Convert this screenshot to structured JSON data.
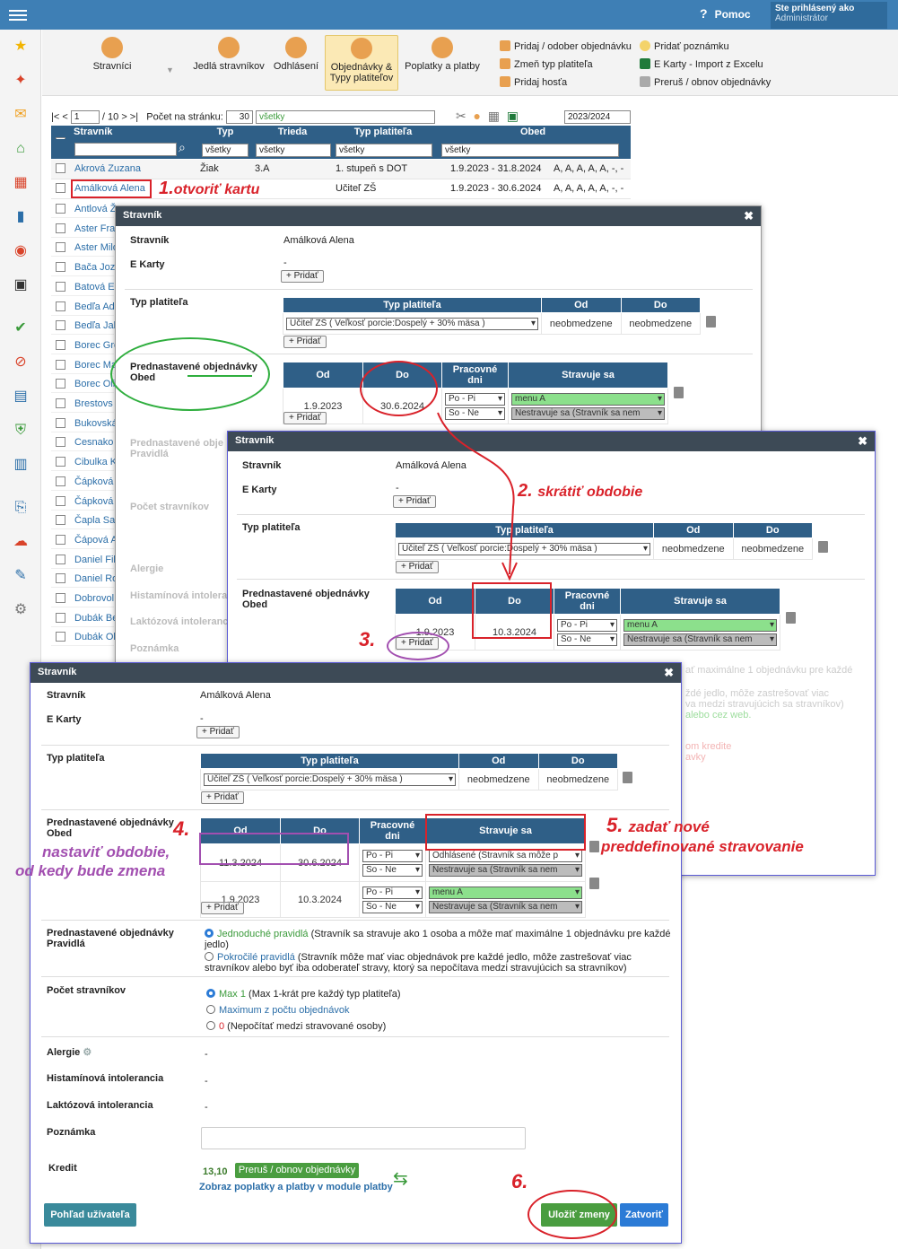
{
  "topbar": {
    "help": "Pomoc",
    "logged_as": "Ste prihlásený ako",
    "role": "Administrátor"
  },
  "ribbon": {
    "buttons": [
      "Stravníci",
      "Jedlá stravníkov",
      "Odhlásení",
      "Objednávky &",
      "Typy platiteľov",
      "Poplatky a platby"
    ],
    "actions": [
      "Pridaj / odober objednávku",
      "Zmeň typ platiteľa",
      "Pridaj hosťa",
      "Pridať poznámku",
      "E Karty - Import z Excelu",
      "Preruš / obnov objednávky"
    ]
  },
  "pager": {
    "first": "|< <",
    "page": "1",
    "of": "/ 10",
    "next": "> >|",
    "per_page_label": "Počet na stránku:",
    "per_page": "30",
    "filter": "všetky",
    "year": "2023/2024"
  },
  "grid": {
    "headers": [
      "Stravník",
      "Typ",
      "Trieda",
      "Typ platiteľa",
      "Obed"
    ],
    "filters": [
      "všetky",
      "všetky",
      "všetky",
      "všetky"
    ],
    "rows": [
      [
        "Akrová Zuzana",
        "Žiak",
        "3.A",
        "1. stupeň  s DOT",
        "1.9.2023 - 31.8.2024",
        "A, A, A, A, A, -, -"
      ],
      [
        "Amálková Alena",
        "",
        "",
        "Učiteľ ZŠ",
        "1.9.2023 - 30.6.2024",
        "A, A, A, A, A, -, -"
      ]
    ],
    "names": [
      "Antlová Ž",
      "Aster Fra",
      "Aster Milo",
      "Bača Joz",
      "Batová Er",
      "Bedľa Ad",
      "Bedľa Jak",
      "Borec Gre",
      "Borec Ma",
      "Borec Oli",
      "Brestovs",
      "Bukovská",
      "Cesnako",
      "Cibulka K",
      "Čápková",
      "Čápková",
      "Čapla Sa",
      "Čápová A",
      "Daniel Fil",
      "Daniel Ro",
      "Dobrovol",
      "Dubák Be",
      "Dubák Ol"
    ]
  },
  "modal": {
    "title": "Stravník",
    "stravnik_label": "Stravník",
    "stravnik_name": "Amálková Alena",
    "ekarty_label": "E Karty",
    "dash": "-",
    "add": "+ Pridať",
    "typ_label": "Typ platiteľa",
    "typ_headers": [
      "Typ platiteľa",
      "Od",
      "Do"
    ],
    "typ_value": "Učiteľ ZŠ ( Veľkosť porcie:Dospelý + 30% mäsa )",
    "unlimited": "neobmedzene",
    "pred_label": "Prednastavené objednávky",
    "pred_sub": "Obed",
    "pred_headers": [
      "Od",
      "Do",
      "Pracovné dni",
      "Stravuje sa"
    ],
    "od1": "1.9.2023",
    "do1": "30.6.2024",
    "do2": "10.3.2024",
    "od_new": "11.3.2024",
    "do_new": "30.6.2024",
    "popi": "Po - Pi",
    "sone": "So - Ne",
    "menu_a": "menu A",
    "nestravuje": "Nestravuje sa (Stravník sa nem",
    "odhlasene": "Odhlásené (Stravník sa môže p",
    "pravidla_label": "Prednastavené objednávky",
    "pravidla_sub": "Pravidlá",
    "jednoduche": "Jednoduché pravidlá",
    "jednoduche_desc": " (Stravník sa stravuje ako 1 osoba a môže mať maximálne 1 objednávku pre každé jedlo)",
    "pokrocile": "Pokročilé pravidlá",
    "pokrocile_desc": " (Stravník môže mať viac objednávok pre každé jedlo, môže zastrešovať viac stravníkov alebo byť iba odoberateľ stravy, ktorý sa nepočítava medzi stravujúcich sa stravníkov)",
    "pocet_label": "Počet stravníkov",
    "max1": "Max 1",
    "max1_desc": " (Max 1-krát pre každý typ platiteľa)",
    "maximum": "Maximum z počtu objednávok",
    "zero": "0",
    "zero_desc": " (Nepočítať medzi stravované osoby)",
    "alergie": "Alergie",
    "histamin": "Histamínová intolerancia",
    "laktoza": "Laktózová intolerancia",
    "poznamka": "Poznámka",
    "kredit": "Kredit",
    "kredit_val": "13,10",
    "prerus": "Preruš / obnov objednávky",
    "zobraz": "Zobraz poplatky a platby v module platby",
    "pohlad": "Pohľad užívateľa",
    "ulozit": "Uložiť zmeny",
    "zatvorit": "Zatvoriť",
    "bg_fragments": [
      "Prednastavené obje",
      "Pravidlá",
      "Počet stravníkov",
      "Alergie",
      "Histamínová intolera",
      "Laktózová intoleranc",
      "Poznámka"
    ],
    "m2_fragments": [
      "ať maximálne 1 objednávku pre každé",
      "ždé jedlo, môže zastrešovať viac",
      "va medzi stravujúcich sa stravníkov)",
      "alebo cez web.",
      "om kredite",
      "avky"
    ]
  },
  "annotations": {
    "a1": "1.",
    "a1t": "otvoriť kartu",
    "a2": "2.",
    "a2t": "skrátiť obdobie",
    "a3": "3.",
    "a4": "4.",
    "a4t1": "nastaviť  obdobie,",
    "a4t2": "od kedy bude zmena",
    "a5": "5.",
    "a5t1": "zadať nové",
    "a5t2": "preddefinované stravovanie",
    "a6": "6."
  }
}
